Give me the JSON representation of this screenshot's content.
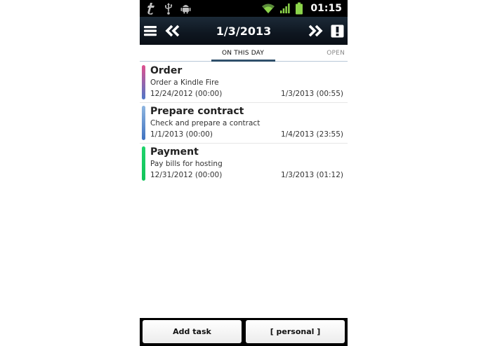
{
  "statusbar": {
    "time": "01:15",
    "left_icons": [
      "talkback-icon",
      "usb-icon",
      "android-debug-icon"
    ],
    "right_icons": [
      "wifi-icon",
      "signal-icon",
      "battery-icon"
    ]
  },
  "header": {
    "date": "1/3/2013",
    "menu_icon": "menu-icon",
    "prev_icon": "double-chevron-left-icon",
    "next_icon": "double-chevron-right-icon",
    "alert_icon": "exclamation-icon"
  },
  "tabs": {
    "active": "ON THIS DAY",
    "other": "OPEN"
  },
  "tasks": [
    {
      "title": "Order",
      "description": "Order a Kindle Fire",
      "start": "12/24/2012 (00:00)",
      "end": "1/3/2013 (00:55)",
      "color_top": "#e0508e",
      "color_bottom": "#4f78c8"
    },
    {
      "title": "Prepare contract",
      "description": "Check and prepare a contract",
      "start": "1/1/2013 (00:00)",
      "end": "1/4/2013 (23:55)",
      "color_top": "#8fb6e0",
      "color_bottom": "#3f72c0"
    },
    {
      "title": "Payment",
      "description": "Pay bills for hosting",
      "start": "12/31/2012 (00:00)",
      "end": "1/3/2013 (01:12)",
      "color_top": "#1fd36c",
      "color_bottom": "#12c45a"
    }
  ],
  "bottom": {
    "add_task": "Add task",
    "category": "[ personal ]"
  },
  "colors": {
    "header_bg": "#0e1620",
    "tab_underline": "#2f4f6a",
    "statusbar_bg": "#000000"
  }
}
